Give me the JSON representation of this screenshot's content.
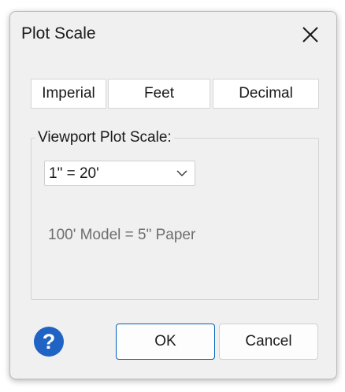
{
  "dialog": {
    "title": "Plot Scale",
    "close_icon": "close-icon"
  },
  "unit_buttons": {
    "imperial": "Imperial",
    "feet": "Feet",
    "decimal": "Decimal"
  },
  "viewport": {
    "label": "Viewport Plot Scale:",
    "selected_scale": "1\" = 20'",
    "scale_description": "100' Model = 5\" Paper"
  },
  "footer": {
    "help_icon": "help-icon",
    "ok_label": "OK",
    "cancel_label": "Cancel"
  },
  "colors": {
    "dialog_background": "#f0f0f0",
    "help_icon": "#1f63c4",
    "ok_border": "#005fb8",
    "description_text": "#6e6e6e"
  }
}
